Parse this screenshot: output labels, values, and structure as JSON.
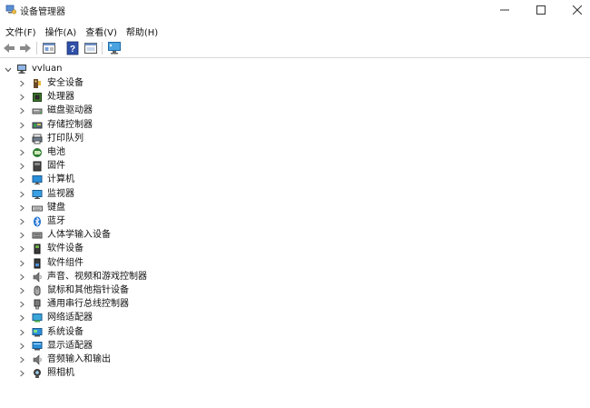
{
  "window": {
    "title": "设备管理器"
  },
  "menu": [
    {
      "label": "文件(F)"
    },
    {
      "label": "操作(A)"
    },
    {
      "label": "查看(V)"
    },
    {
      "label": "帮助(H)"
    }
  ],
  "toolbar": {
    "icons": [
      "back-arrow-icon",
      "forward-arrow-icon",
      "properties-icon",
      "help-icon",
      "show-hidden-icon",
      "scan-hardware-icon"
    ]
  },
  "tree": {
    "root": {
      "label": "vvluan",
      "expanded": true
    },
    "categories": [
      {
        "label": "安全设备",
        "icon": "security-device-icon"
      },
      {
        "label": "处理器",
        "icon": "processor-icon"
      },
      {
        "label": "磁盘驱动器",
        "icon": "disk-drive-icon"
      },
      {
        "label": "存储控制器",
        "icon": "storage-controller-icon"
      },
      {
        "label": "打印队列",
        "icon": "print-queue-icon"
      },
      {
        "label": "电池",
        "icon": "battery-icon"
      },
      {
        "label": "固件",
        "icon": "firmware-icon"
      },
      {
        "label": "计算机",
        "icon": "computer-icon"
      },
      {
        "label": "监视器",
        "icon": "monitor-icon"
      },
      {
        "label": "键盘",
        "icon": "keyboard-icon"
      },
      {
        "label": "蓝牙",
        "icon": "bluetooth-icon"
      },
      {
        "label": "人体学输入设备",
        "icon": "hid-icon"
      },
      {
        "label": "软件设备",
        "icon": "software-device-icon"
      },
      {
        "label": "软件组件",
        "icon": "software-component-icon"
      },
      {
        "label": "声音、视频和游戏控制器",
        "icon": "sound-icon"
      },
      {
        "label": "鼠标和其他指针设备",
        "icon": "mouse-icon"
      },
      {
        "label": "通用串行总线控制器",
        "icon": "usb-icon"
      },
      {
        "label": "网络适配器",
        "icon": "network-adapter-icon"
      },
      {
        "label": "系统设备",
        "icon": "system-device-icon"
      },
      {
        "label": "显示适配器",
        "icon": "display-adapter-icon"
      },
      {
        "label": "音频输入和输出",
        "icon": "audio-io-icon"
      },
      {
        "label": "照相机",
        "icon": "camera-icon"
      }
    ]
  }
}
